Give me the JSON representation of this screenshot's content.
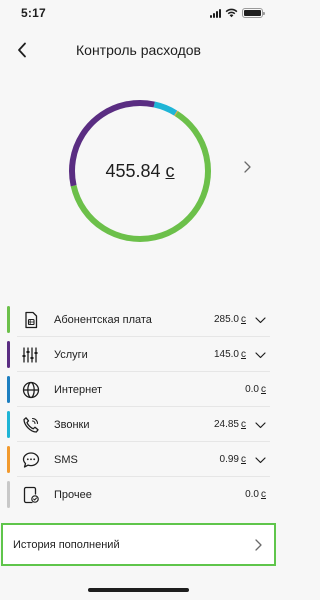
{
  "status_bar": {
    "time": "5:17"
  },
  "header": {
    "title": "Контроль расходов"
  },
  "summary": {
    "total": "455.84",
    "currency": "c"
  },
  "donut": {
    "segments": [
      {
        "category": "Абонентская плата",
        "value": 285.0,
        "color": "#6cc04a"
      },
      {
        "category": "Услуги",
        "value": 145.0,
        "color": "#5a2d82"
      },
      {
        "category": "Звонки",
        "value": 24.85,
        "color": "#1fb5d6"
      },
      {
        "category": "SMS",
        "value": 0.99,
        "color": "#f29a2e"
      }
    ]
  },
  "expenses": [
    {
      "label": "Абонентская плата",
      "amount": "285.0",
      "currency": "c",
      "color": "#6cc04a",
      "icon": "sim-card-icon"
    },
    {
      "label": "Услуги",
      "amount": "145.0",
      "currency": "c",
      "color": "#5a2d82",
      "icon": "services-sliders-icon"
    },
    {
      "label": "Интернет",
      "amount": "0.0",
      "currency": "c",
      "color": "#1e7fc0",
      "icon": "globe-icon"
    },
    {
      "label": "Звонки",
      "amount": "24.85",
      "currency": "c",
      "color": "#1fb5d6",
      "icon": "phone-icon"
    },
    {
      "label": "SMS",
      "amount": "0.99",
      "currency": "c",
      "color": "#f29a2e",
      "icon": "sms-bubble-icon"
    },
    {
      "label": "Прочее",
      "amount": "0.0",
      "currency": "c",
      "color": "#c8c8c8",
      "icon": "other-document-icon"
    }
  ],
  "history": {
    "label": "История пополнений"
  },
  "colors": {
    "accent": "#5fc54b",
    "text": "#1e1e1e",
    "background": "#f7f7f7"
  }
}
